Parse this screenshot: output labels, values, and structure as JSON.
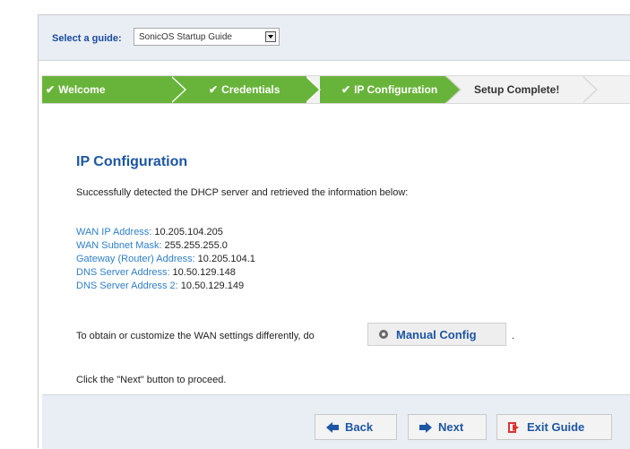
{
  "guide": {
    "label": "Select a guide:",
    "selected": "SonicOS Startup Guide"
  },
  "steps": [
    {
      "label": "Welcome",
      "status": "done"
    },
    {
      "label": "Credentials",
      "status": "done"
    },
    {
      "label": "IP Configuration",
      "status": "done"
    },
    {
      "label": "Setup Complete!",
      "status": "current"
    }
  ],
  "check_glyph": "✔",
  "content": {
    "title": "IP Configuration",
    "intro": "Successfully detected the DHCP server and retrieved the information below:",
    "fields": [
      {
        "label": "WAN IP Address:",
        "value": "10.205.104.205"
      },
      {
        "label": "WAN Subnet Mask:",
        "value": "255.255.255.0"
      },
      {
        "label": "Gateway (Router) Address:",
        "value": "10.205.104.1"
      },
      {
        "label": "DNS Server Address:",
        "value": "10.50.129.148"
      },
      {
        "label": "DNS Server Address 2:",
        "value": "10.50.129.149"
      }
    ],
    "customize_text": "To obtain or customize the WAN settings differently, do",
    "manual_config_label": "Manual Config",
    "trailing_period": ".",
    "proceed_text": "Click the \"Next\" button to proceed."
  },
  "footer": {
    "back_label": "Back",
    "next_label": "Next",
    "exit_label": "Exit Guide"
  },
  "colors": {
    "done_step": "#68b43a",
    "heading": "#1d56a3",
    "field_label": "#2f7fc9",
    "exit_icon": "#dd3333"
  }
}
